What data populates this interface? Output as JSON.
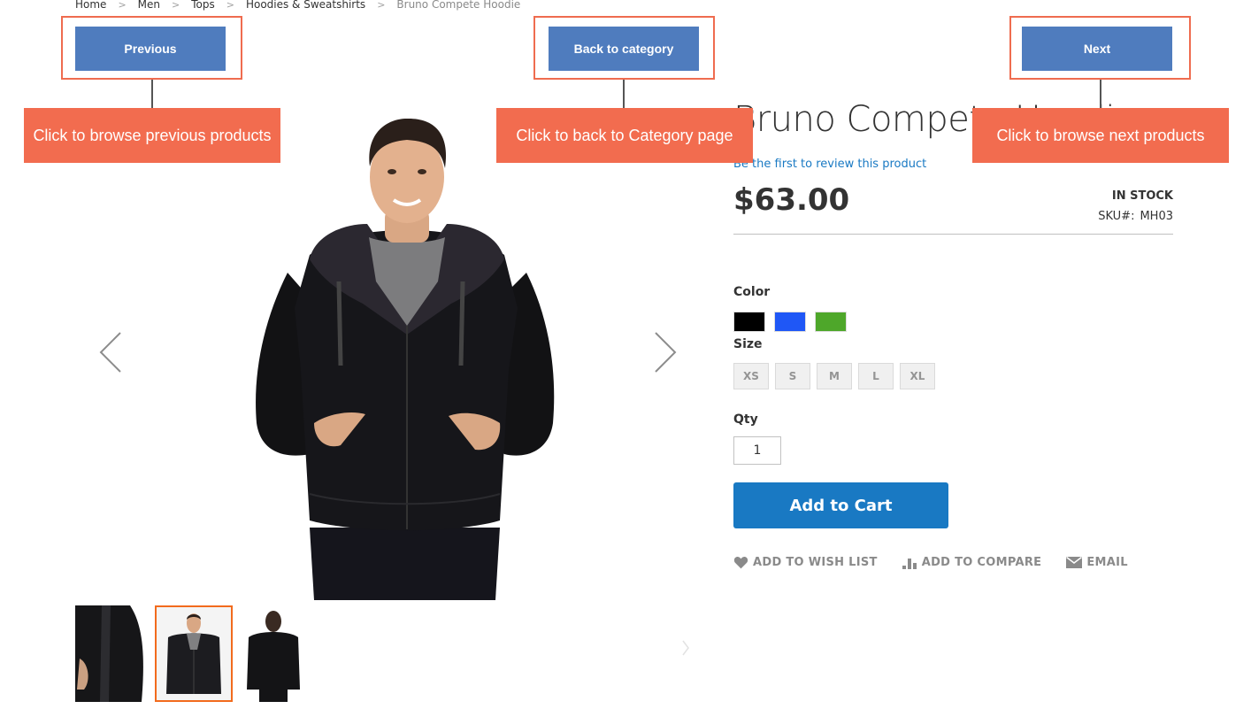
{
  "breadcrumb": {
    "items": [
      "Home",
      "Men",
      "Tops",
      "Hoodies & Sweatshirts"
    ],
    "current": "Bruno Compete Hoodie",
    "separator": ">"
  },
  "annotations": {
    "previous": {
      "button_label": "Previous",
      "callout": "Click to browse previous products"
    },
    "back": {
      "button_label": "Back to category",
      "callout": "Click to back to Category page"
    },
    "next": {
      "button_label": "Next",
      "callout": "Click to browse next products"
    },
    "colors": {
      "button": "#4f7cbe",
      "callout": "#f26c4f",
      "highlight_border": "#ef6c4f"
    }
  },
  "gallery": {
    "main_image_alt": "Bruno Compete Hoodie - front view",
    "thumbnails": [
      {
        "alt": "Hoodie pocket detail",
        "active": false
      },
      {
        "alt": "Hoodie front view",
        "active": true
      },
      {
        "alt": "Hoodie back view",
        "active": false
      }
    ],
    "prev_icon": "chevron-left-icon",
    "next_icon": "chevron-right-icon"
  },
  "product": {
    "title": "Bruno Compete Hoodie",
    "review_link": "Be the first to review this product",
    "price": "$63.00",
    "stock_status": "IN STOCK",
    "sku_label": "SKU#:",
    "sku_value": "MH03",
    "color_label": "Color",
    "colors": [
      {
        "name": "Black",
        "hex": "#000000"
      },
      {
        "name": "Blue",
        "hex": "#1f57f6"
      },
      {
        "name": "Green",
        "hex": "#4ea72a"
      }
    ],
    "size_label": "Size",
    "sizes": [
      "XS",
      "S",
      "M",
      "L",
      "XL"
    ],
    "qty_label": "Qty",
    "qty_value": "1",
    "add_to_cart": "Add to Cart",
    "actions": {
      "wishlist": "ADD TO WISH LIST",
      "compare": "ADD TO COMPARE",
      "email": "EMAIL"
    },
    "accent_color": "#1979c3"
  }
}
